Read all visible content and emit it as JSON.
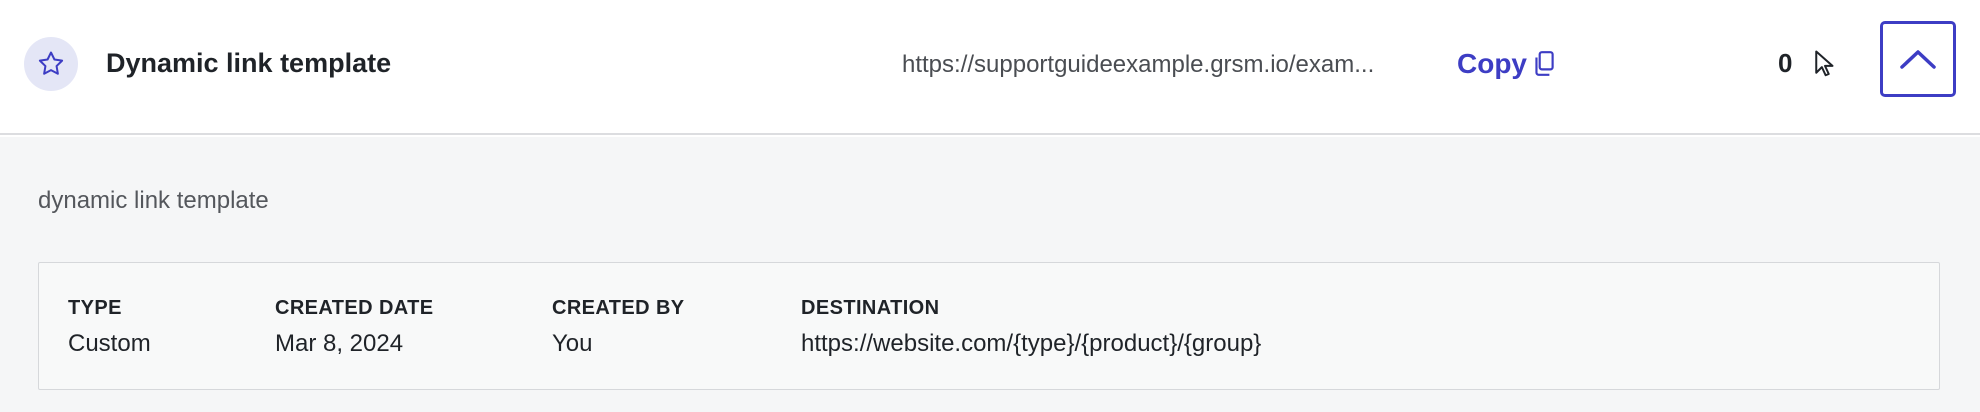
{
  "link": {
    "title": "Dynamic link template",
    "short_url": "https://supportguideexample.grsm.io/exam...",
    "copy_label": "Copy",
    "click_count": "0",
    "description": "dynamic link template"
  },
  "details": {
    "type_label": "TYPE",
    "type_value": "Custom",
    "created_date_label": "CREATED DATE",
    "created_date_value": "Mar 8, 2024",
    "created_by_label": "CREATED BY",
    "created_by_value": "You",
    "destination_label": "DESTINATION",
    "destination_value": "https://website.com/{type}/{product}/{group}"
  },
  "icons": {
    "favorite": "star-icon",
    "copy": "copy-icon",
    "clicks": "cursor-icon",
    "collapse": "chevron-up-icon"
  },
  "colors": {
    "accent": "#3d3dc4",
    "star_badge_bg": "#e4e6f6",
    "panel_bg": "#f5f6f7"
  }
}
